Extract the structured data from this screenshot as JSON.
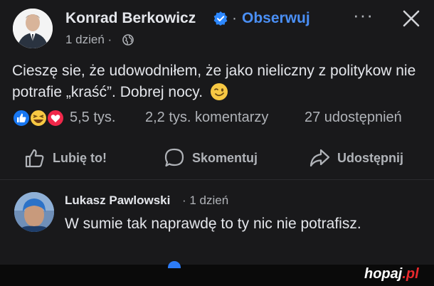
{
  "post": {
    "author": "Konrad Berkowicz",
    "separator": "·",
    "follow_label": "Obserwuj",
    "more_label": "···",
    "time": "1 dzień ·",
    "text": "Cieszę sie, że udowodniłem, że jako nieliczny z politykow nie potrafie „kraść”. Dobrej nocy.",
    "reactions_count": "5,5 tys.",
    "comments_count": "2,2 tys. komentarzy",
    "shares_count": "27 udostępnień"
  },
  "actions": {
    "like_label": "Lubię to!",
    "comment_label": "Skomentuj",
    "share_label": "Udostępnij"
  },
  "comment": {
    "author": "Lukasz Pawlowski",
    "time": "· 1 dzień",
    "text": "W sumie tak naprawdę  to ty nic nie potrafisz."
  },
  "watermark": {
    "main": "hopaj",
    "suffix": ".pl"
  },
  "colors": {
    "background": "#19191b",
    "link_blue": "#4a8ff5",
    "text_primary": "#e4e6eb",
    "text_secondary": "#b0b3b8",
    "like_blue": "#1877f2",
    "haha_yellow": "#f7c843",
    "love_red": "#f0284a",
    "watermark_red": "#e8292d"
  },
  "icons": [
    "verified-icon",
    "close-icon",
    "globe-icon",
    "wink-emoji-icon",
    "like-reaction-icon",
    "haha-reaction-icon",
    "love-reaction-icon",
    "thumbs-up-icon",
    "comment-bubble-icon",
    "share-arrow-icon"
  ]
}
